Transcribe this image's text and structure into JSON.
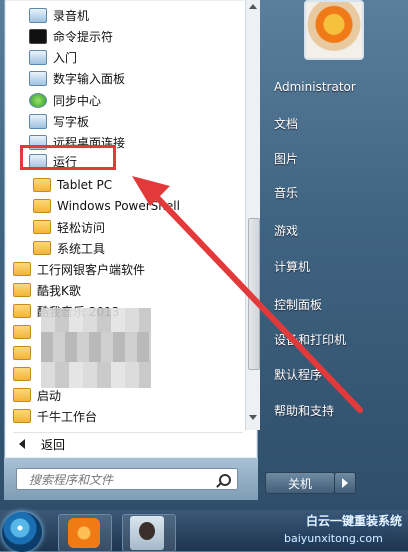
{
  "programs": [
    {
      "label": "录音机",
      "kind": "app"
    },
    {
      "label": "命令提示符",
      "kind": "app"
    },
    {
      "label": "入门",
      "kind": "app"
    },
    {
      "label": "数字输入面板",
      "kind": "app"
    },
    {
      "label": "同步中心",
      "kind": "app"
    },
    {
      "label": "写字板",
      "kind": "app"
    },
    {
      "label": "远程桌面连接",
      "kind": "app"
    },
    {
      "label": "运行",
      "kind": "app"
    },
    {
      "label": "Tablet PC",
      "kind": "folder"
    },
    {
      "label": "Windows PowerShell",
      "kind": "folder"
    },
    {
      "label": "轻松访问",
      "kind": "folder"
    },
    {
      "label": "系统工具",
      "kind": "folder"
    }
  ],
  "top_programs": [
    {
      "label": "工行网银客户端软件"
    },
    {
      "label": "酷我K歌"
    },
    {
      "label": "酷我音乐 2013"
    },
    {
      "label": ""
    },
    {
      "label": ""
    },
    {
      "label": ""
    },
    {
      "label": "启动"
    },
    {
      "label": "千牛工作台"
    }
  ],
  "back_label": "返回",
  "search_placeholder": "搜索程序和文件",
  "user_name": "Administrator",
  "right_menu": [
    "文档",
    "图片",
    "音乐",
    "游戏",
    "计算机",
    "控制面板",
    "设备和打印机",
    "默认程序",
    "帮助和支持"
  ],
  "shutdown_label": "关机",
  "watermark_line1": "白云一键重装系统",
  "watermark_line2": "baiyunxitong.com",
  "annotation_color": "#e23a3a"
}
